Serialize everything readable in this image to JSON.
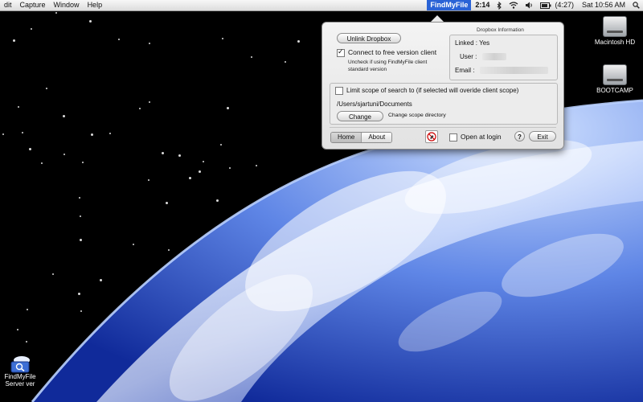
{
  "menubar": {
    "left_items": [
      "dit",
      "Capture",
      "Window",
      "Help"
    ],
    "app_name": "FindMyFile",
    "time_remaining": "2:14",
    "battery": "(4:27)",
    "clock": "Sat 10:56 AM"
  },
  "desktop_icons": {
    "macintosh_hd": "Macintosh HD",
    "bootcamp": "BOOTCAMP",
    "findmyfile_server": "FindMyFileServer ver"
  },
  "panel": {
    "unlink_button": "Unlink Dropbox",
    "connect_free_label": "Connect to free version client",
    "connect_free_checked": true,
    "connect_hint_line1": "Uncheck if using FindMyFile client",
    "connect_hint_line2": "standard version",
    "dropbox_info_title": "Dropbox Information",
    "linked_label": "Linked :",
    "linked_value": "Yes",
    "user_label": "User :",
    "email_label": "Email :",
    "limit_scope_label": "Limit scope of search to (if selected will overide client scope)",
    "limit_scope_checked": false,
    "scope_path": "/Users/sjartuni/Documents",
    "change_button": "Change",
    "change_hint": "Change scope directory",
    "tab_home": "Home",
    "tab_about": "About",
    "open_at_login_label": "Open at login",
    "open_at_login_checked": false,
    "help_button": "?",
    "exit_button": "Exit"
  },
  "colors": {
    "menubar_highlight": "#2a63d6",
    "earth_blue": "#1f4fd0",
    "space": "#000000"
  }
}
